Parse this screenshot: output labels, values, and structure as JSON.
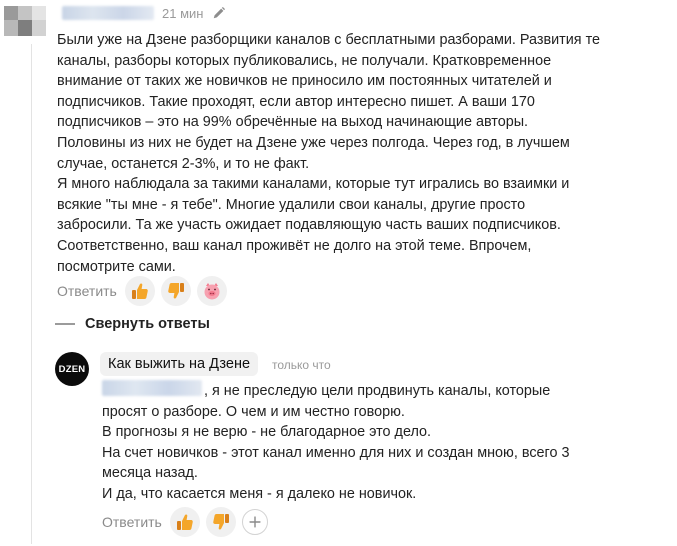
{
  "comment": {
    "timestamp": "21 мин",
    "lines": [
      "Были уже на Дзене разборщики каналов с бесплатными разборами. Развития те",
      "каналы, разборы которых публиковались, не получали. Кратковременное",
      "внимание от таких же новичков не приносило им постоянных читателей и",
      "подписчиков. Такие проходят, если автор интересно пишет. А ваши 170",
      "подписчиков – это на 99% обречённые на выход начинающие авторы.",
      "Половины из них не будет на Дзене уже через полгода. Через год, в лучшем",
      "случае, останется 2-3%, и то не факт.",
      "Я много наблюдала за такими каналами, которые тут игрались во взаимки и",
      "всякие \"ты мне - я тебе\". Многие удалили свои каналы, другие просто",
      "забросили. Та же участь ожидает подавляющую часть ваших подписчиков.",
      "Соответственно, ваш канал проживёт не долго на этой теме. Впрочем,",
      "посмотрите сами."
    ],
    "reply_label": "Ответить"
  },
  "collapse_label": "Свернуть ответы",
  "reply": {
    "avatar_text": "DZEN",
    "author": "Как выжить на Дзене",
    "timestamp": "только что",
    "lines": [
      ", я не преследую цели продвинуть каналы, которые",
      "просят о разборе. О чем и им честно говорю.",
      "В прогнозы я не верю - не благодарное это дело.",
      "На счет новичков - этот канал именно для них и создан мною, всего 3",
      "месяца назад.",
      "И да, что касается меня - я далеко не новичок."
    ],
    "reply_label": "Ответить"
  },
  "icons": {
    "like": "thumbs-up-icon",
    "dislike": "thumbs-down-icon",
    "pig": "pig-face-icon",
    "add_reaction": "plus-icon",
    "edit": "pencil-icon"
  },
  "colors": {
    "like": "#f29a1e",
    "dislike": "#f29a1e",
    "pig": "#f47a8e"
  }
}
